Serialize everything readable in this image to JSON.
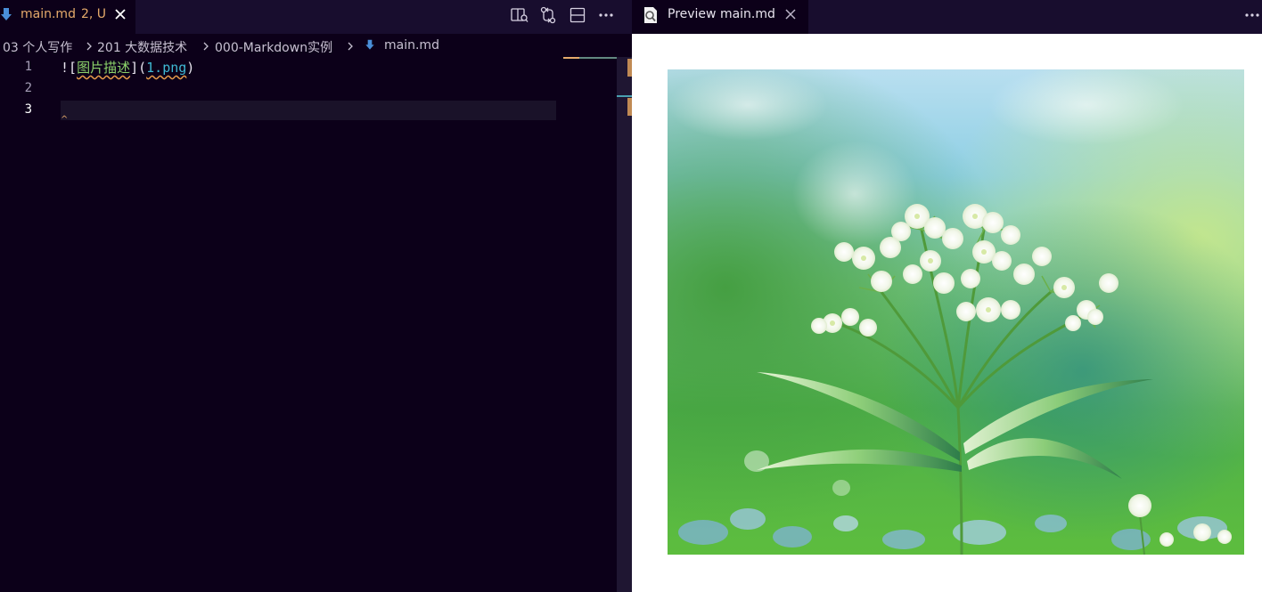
{
  "editor": {
    "tab": {
      "filename": "main.md",
      "status": "2, U"
    },
    "actions": [
      "open-preview-to-side-icon",
      "git-compare-icon",
      "split-editor-icon",
      "more-actions-icon"
    ],
    "breadcrumb": [
      "03 个人写作",
      "201 大数据技术",
      "000-Markdown实例",
      "main.md"
    ],
    "line_numbers": [
      "1",
      "2",
      "3"
    ],
    "code": {
      "bang": "!",
      "open_bracket": "[",
      "alt_text": "图片描述",
      "close_bracket": "]",
      "open_paren": "(",
      "link": "1.png",
      "close_paren": ")"
    }
  },
  "preview": {
    "tab_label": "Preview main.md",
    "image": {
      "alt": "图片描述",
      "src_name": "1.png"
    }
  },
  "colors": {
    "editor_bg": "#0c0019",
    "tabbar_bg": "#180d2e",
    "accent_modified": "#e5aa6b",
    "markdown_link": "#3fb8d3",
    "markdown_alt": "#8bd36a"
  }
}
